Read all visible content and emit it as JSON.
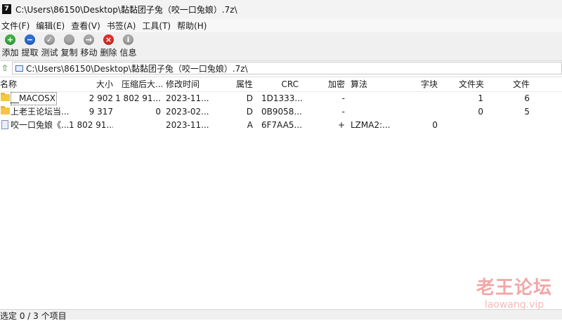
{
  "window": {
    "title": "C:\\Users\\86150\\Desktop\\黏黏团子兔（咬一口兔娘）.7z\\",
    "icon_text": "7"
  },
  "menu": [
    "文件(F)",
    "编辑(E)",
    "查看(V)",
    "书签(A)",
    "工具(T)",
    "帮助(H)"
  ],
  "toolbar": [
    {
      "label": "添加",
      "icon": "plus-icon",
      "symbol": "+",
      "color": "#3cb043"
    },
    {
      "label": "提取",
      "icon": "minus-icon",
      "symbol": "−",
      "color": "#2e6fd6"
    },
    {
      "label": "测试",
      "icon": "check-icon",
      "symbol": "✓",
      "color": "#a8a8a8"
    },
    {
      "label": "复制",
      "icon": "copy-icon",
      "symbol": "",
      "color": "#a8a8a8"
    },
    {
      "label": "移动",
      "icon": "arrow-right-icon",
      "symbol": "→",
      "color": "#a8a8a8"
    },
    {
      "label": "删除",
      "icon": "delete-icon",
      "symbol": "×",
      "color": "#e0302a"
    },
    {
      "label": "信息",
      "icon": "info-icon",
      "symbol": "i",
      "color": "#a8a8a8"
    }
  ],
  "address": {
    "path": "C:\\Users\\86150\\Desktop\\黏黏团子兔（咬一口兔娘）.7z\\"
  },
  "columns": {
    "name": "名称",
    "size": "大小",
    "packed": "压缩后大...",
    "modified": "修改时间",
    "attributes": "属性",
    "crc": "CRC",
    "encrypted": "加密",
    "method": "算法",
    "block": "字块",
    "folders": "文件夹",
    "files": "文件"
  },
  "rows": [
    {
      "type": "folder",
      "name": "__MACOSX",
      "size": "2 902",
      "packed": "1 802 91...",
      "modified": "2023-11...",
      "attributes": "D",
      "crc": "1D1333...",
      "encrypted": "-",
      "method": "",
      "block": "",
      "folders": "1",
      "files": "6"
    },
    {
      "type": "folder",
      "name": "上老王论坛当...",
      "size": "9 317",
      "packed": "0",
      "modified": "2023-02...",
      "attributes": "D",
      "crc": "0B9058...",
      "encrypted": "-",
      "method": "",
      "block": "",
      "folders": "0",
      "files": "5"
    },
    {
      "type": "file",
      "name": "咬一口兔娘《...",
      "size": "1 802 91...",
      "packed": "",
      "modified": "2023-11...",
      "attributes": "A",
      "crc": "6F7AA5...",
      "encrypted": "+",
      "method": "LZMA2:...",
      "block": "0",
      "folders": "",
      "files": ""
    }
  ],
  "status": {
    "text": "选定 0 / 3 个项目"
  },
  "watermark": {
    "line1": "老王论坛",
    "line2": "laowang.vip"
  }
}
